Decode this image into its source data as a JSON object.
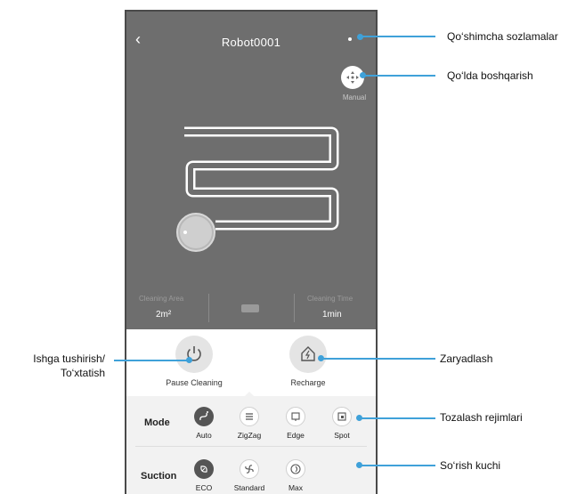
{
  "header": {
    "back_icon": "chevron-left-icon",
    "title": "Robot0001",
    "more_icon": "more-dots-icon"
  },
  "manual": {
    "label": "Manual",
    "icon": "dpad-icon"
  },
  "stats": {
    "area_label": "Cleaning Area",
    "area_value": "2m²",
    "battery_icon": "battery-icon",
    "time_label": "Cleaning Time",
    "time_value": "1min"
  },
  "actions": {
    "pause_label": "Pause Cleaning",
    "recharge_label": "Recharge"
  },
  "mode": {
    "title": "Mode",
    "options": [
      {
        "label": "Auto",
        "icon": "auto-icon",
        "active": true
      },
      {
        "label": "ZigZag",
        "icon": "zigzag-icon",
        "active": false
      },
      {
        "label": "Edge",
        "icon": "edge-icon",
        "active": false
      },
      {
        "label": "Spot",
        "icon": "spot-icon",
        "active": false
      }
    ]
  },
  "suction": {
    "title": "Suction",
    "options": [
      {
        "label": "ECO",
        "icon": "eco-icon",
        "active": true
      },
      {
        "label": "Standard",
        "icon": "fan-icon",
        "active": false
      },
      {
        "label": "Max",
        "icon": "swirl-icon",
        "active": false
      }
    ]
  },
  "callouts": {
    "more_settings": "Qo‘shimcha sozlamalar",
    "manual_control": "Qo‘lda boshqarish",
    "start_stop_line1": "Ishga tushirish/",
    "start_stop_line2": "To‘xtatish",
    "charging": "Zaryadlash",
    "cleaning_modes": "Tozalash rejimlari",
    "suction_power": "So‘rish kuchi"
  },
  "colors": {
    "accent": "#3fa1d9",
    "phone_bg": "#6e6e6e",
    "active_chip": "#555555"
  }
}
